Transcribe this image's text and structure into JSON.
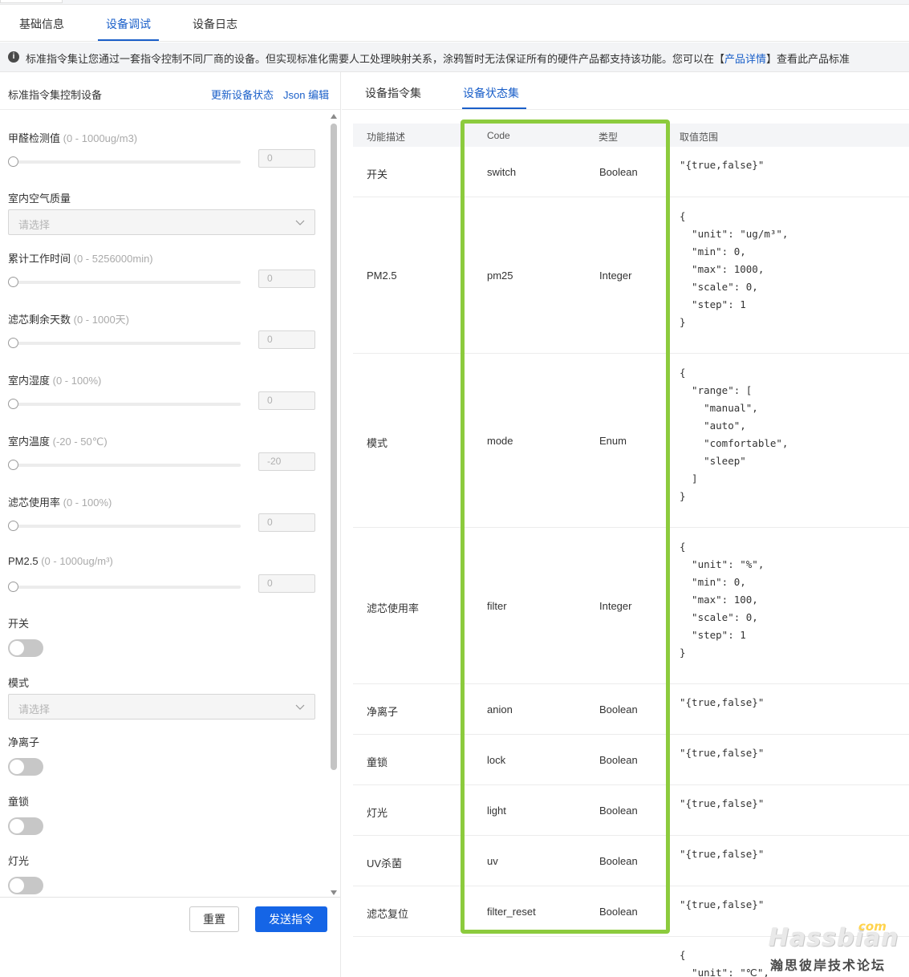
{
  "top_tabs": [
    "基础信息",
    "设备调试",
    "设备日志"
  ],
  "notice": {
    "text_before": "标准指令集让您通过一套指令控制不同厂商的设备。但实现标准化需要人工处理映射关系，涂鸦暂时无法保证所有的硬件产品都支持该功能。您可以在【",
    "link": "产品详情",
    "text_after": "】查看此产品标准"
  },
  "left_panel": {
    "title": "标准指令集控制设备",
    "link_update": "更新设备状态",
    "link_json": "Json 编辑",
    "fields": {
      "formaldehyde": {
        "label": "甲醛检测值",
        "range": "(0 - 1000ug/m3)",
        "value": "0"
      },
      "air_quality": {
        "label": "室内空气质量",
        "placeholder": "请选择"
      },
      "work_time": {
        "label": "累计工作时间",
        "range": "(0 - 5256000min)",
        "value": "0"
      },
      "filter_days": {
        "label": "滤芯剩余天数",
        "range": "(0 - 1000天)",
        "value": "0"
      },
      "humidity": {
        "label": "室内湿度",
        "range": "(0 - 100%)",
        "value": "0"
      },
      "temperature": {
        "label": "室内温度",
        "range": "(-20 - 50℃)",
        "value": "-20"
      },
      "filter_usage": {
        "label": "滤芯使用率",
        "range": "(0 - 100%)",
        "value": "0"
      },
      "pm25": {
        "label": "PM2.5",
        "range": "(0 - 1000ug/m³)",
        "value": "0"
      },
      "switch": {
        "label": "开关",
        "on": false
      },
      "mode": {
        "label": "模式",
        "placeholder": "请选择"
      },
      "anion": {
        "label": "净离子",
        "on": false
      },
      "lock": {
        "label": "童锁",
        "on": false
      },
      "light": {
        "label": "灯光",
        "on": false
      }
    },
    "btn_reset": "重置",
    "btn_send": "发送指令"
  },
  "right_panel": {
    "tabs": [
      "设备指令集",
      "设备状态集"
    ],
    "headers": [
      "功能描述",
      "Code",
      "类型",
      "取值范围"
    ],
    "rows": [
      {
        "desc": "开关",
        "code": "switch",
        "type": "Boolean",
        "range": "\"{true,false}\""
      },
      {
        "desc": "PM2.5",
        "code": "pm25",
        "type": "Integer",
        "range": "{\n  \"unit\": \"ug/m³\",\n  \"min\": 0,\n  \"max\": 1000,\n  \"scale\": 0,\n  \"step\": 1\n}"
      },
      {
        "desc": "模式",
        "code": "mode",
        "type": "Enum",
        "range": "{\n  \"range\": [\n    \"manual\",\n    \"auto\",\n    \"comfortable\",\n    \"sleep\"\n  ]\n}"
      },
      {
        "desc": "滤芯使用率",
        "code": "filter",
        "type": "Integer",
        "range": "{\n  \"unit\": \"%\",\n  \"min\": 0,\n  \"max\": 100,\n  \"scale\": 0,\n  \"step\": 1\n}"
      },
      {
        "desc": "净离子",
        "code": "anion",
        "type": "Boolean",
        "range": "\"{true,false}\""
      },
      {
        "desc": "童锁",
        "code": "lock",
        "type": "Boolean",
        "range": "\"{true,false}\""
      },
      {
        "desc": "灯光",
        "code": "light",
        "type": "Boolean",
        "range": "\"{true,false}\""
      },
      {
        "desc": "UV杀菌",
        "code": "uv",
        "type": "Boolean",
        "range": "\"{true,false}\""
      },
      {
        "desc": "滤芯复位",
        "code": "filter_reset",
        "type": "Boolean",
        "range": "\"{true,false}\""
      },
      {
        "desc": "",
        "code": "",
        "type": "",
        "range": "{\n  \"unit\": \"℃\","
      }
    ]
  },
  "watermark": {
    "brand": "Hassbian",
    "dotcom": "com",
    "sub": "瀚思彼岸技术论坛"
  },
  "colors": {
    "accent": "#1a5fc9",
    "primary_button": "#1565e6",
    "highlight_box": "#8ccb3d",
    "toggle_off": "#c7c7c7"
  }
}
